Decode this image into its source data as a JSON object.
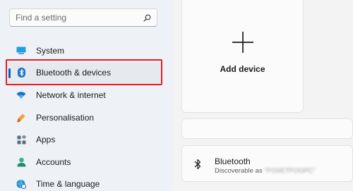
{
  "search": {
    "placeholder": "Find a setting",
    "icon": "search-icon"
  },
  "nav": {
    "items": [
      {
        "label": "System",
        "icon": "display-icon"
      },
      {
        "label": "Bluetooth & devices",
        "icon": "bluetooth-icon",
        "selected": true
      },
      {
        "label": "Network & internet",
        "icon": "wifi-icon"
      },
      {
        "label": "Personalisation",
        "icon": "paintbrush-icon"
      },
      {
        "label": "Apps",
        "icon": "apps-icon"
      },
      {
        "label": "Accounts",
        "icon": "person-icon"
      },
      {
        "label": "Time & language",
        "icon": "globe-clock-icon"
      }
    ]
  },
  "add_device": {
    "label": "Add device",
    "icon": "plus-icon"
  },
  "bluetooth": {
    "title": "Bluetooth",
    "subtitle": "Discoverable as",
    "device_name": "\"FOSETFOGPC\"",
    "icon": "bluetooth-icon"
  },
  "colors": {
    "accent": "#0067c0",
    "highlight": "#e0202a",
    "sidebar_bg": "#eef1f6",
    "card_bg": "#fbfbfb"
  }
}
